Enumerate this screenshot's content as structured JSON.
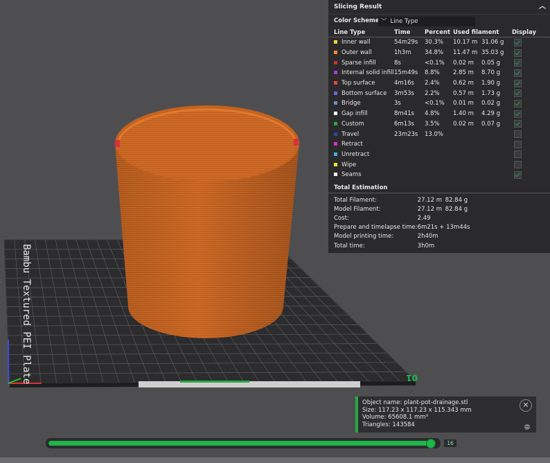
{
  "slicing": {
    "title": "Slicing Result",
    "collapse_icon": "chevron-up-icon",
    "color_scheme_label": "Color Scheme",
    "color_scheme_value": "Line Type",
    "columns": [
      "Line Type",
      "Time",
      "Percent",
      "Used filament",
      "Display"
    ],
    "rows": [
      {
        "name": "Inner wall",
        "color": "#f2d23c",
        "time": "54m29s",
        "percent": "30.3%",
        "length": "10.17 m",
        "weight": "31.06 g",
        "display": true
      },
      {
        "name": "Outer wall",
        "color": "#f08d2e",
        "time": "1h3m",
        "percent": "34.8%",
        "length": "11.47 m",
        "weight": "35.03 g",
        "display": true
      },
      {
        "name": "Sparse infill",
        "color": "#c8322d",
        "time": "8s",
        "percent": "<0.1%",
        "length": "0.02 m",
        "weight": "0.05 g",
        "display": true
      },
      {
        "name": "Internal solid infill",
        "color": "#a43fd0",
        "time": "15m49s",
        "percent": "8.8%",
        "length": "2.85 m",
        "weight": "8.70 g",
        "display": true
      },
      {
        "name": "Top surface",
        "color": "#e8493b",
        "time": "4m16s",
        "percent": "2.4%",
        "length": "0.62 m",
        "weight": "1.90 g",
        "display": true
      },
      {
        "name": "Bottom surface",
        "color": "#6f64e0",
        "time": "3m53s",
        "percent": "2.2%",
        "length": "0.57 m",
        "weight": "1.73 g",
        "display": true
      },
      {
        "name": "Bridge",
        "color": "#6f8ac7",
        "time": "3s",
        "percent": "<0.1%",
        "length": "0.01 m",
        "weight": "0.02 g",
        "display": true
      },
      {
        "name": "Gap infill",
        "color": "#ffffff",
        "time": "8m41s",
        "percent": "4.8%",
        "length": "1.40 m",
        "weight": "4.29 g",
        "display": true
      },
      {
        "name": "Custom",
        "color": "#27a844",
        "time": "6m13s",
        "percent": "3.5%",
        "length": "0.02 m",
        "weight": "0.07 g",
        "display": true
      },
      {
        "name": "Travel",
        "color": "#3145a8",
        "time": "23m23s",
        "percent": "13.0%",
        "length": "",
        "weight": "",
        "display": false
      },
      {
        "name": "Retract",
        "color": "#d92fd0",
        "time": "",
        "percent": "",
        "length": "",
        "weight": "",
        "display": false
      },
      {
        "name": "Unretract",
        "color": "#3bb8d6",
        "time": "",
        "percent": "",
        "length": "",
        "weight": "",
        "display": false
      },
      {
        "name": "Wipe",
        "color": "#f1e32b",
        "time": "",
        "percent": "",
        "length": "",
        "weight": "",
        "display": false
      },
      {
        "name": "Seams",
        "color": "#f2f2f2",
        "time": "",
        "percent": "",
        "length": "",
        "weight": "",
        "display": true
      }
    ],
    "total_estimation_label": "Total Estimation",
    "totals": [
      {
        "label": "Total Filament:",
        "v1": "27.12 m",
        "v2": "82.84 g"
      },
      {
        "label": "Model Filament:",
        "v1": "27.12 m",
        "v2": "82.84 g"
      },
      {
        "label": "Cost:",
        "v1": "2.49",
        "v2": ""
      },
      {
        "label": "Prepare and timelapse time:",
        "v1": "6m21s + 13m44s",
        "v2": ""
      },
      {
        "label": "Model printing time:",
        "v1": "2h40m",
        "v2": ""
      },
      {
        "label": "Total time:",
        "v1": "3h0m",
        "v2": ""
      }
    ]
  },
  "plate": {
    "label": "Bambu Textured PEI Plate",
    "number": "01",
    "model_color": "#d06c26",
    "model_shadow": "#a55520"
  },
  "object_info": {
    "name": "Object name: plant-pot-drainage.stl",
    "size": "Size: 117.23 x 117.23 x 115.343 mm",
    "volume": "Volume: 65608.1 mm³",
    "triangles": "Triangles: 143584",
    "close_icon": "close-icon",
    "collapse_icon": "minus-icon"
  },
  "layer_slider": {
    "value": "16",
    "progress": 0.98
  }
}
